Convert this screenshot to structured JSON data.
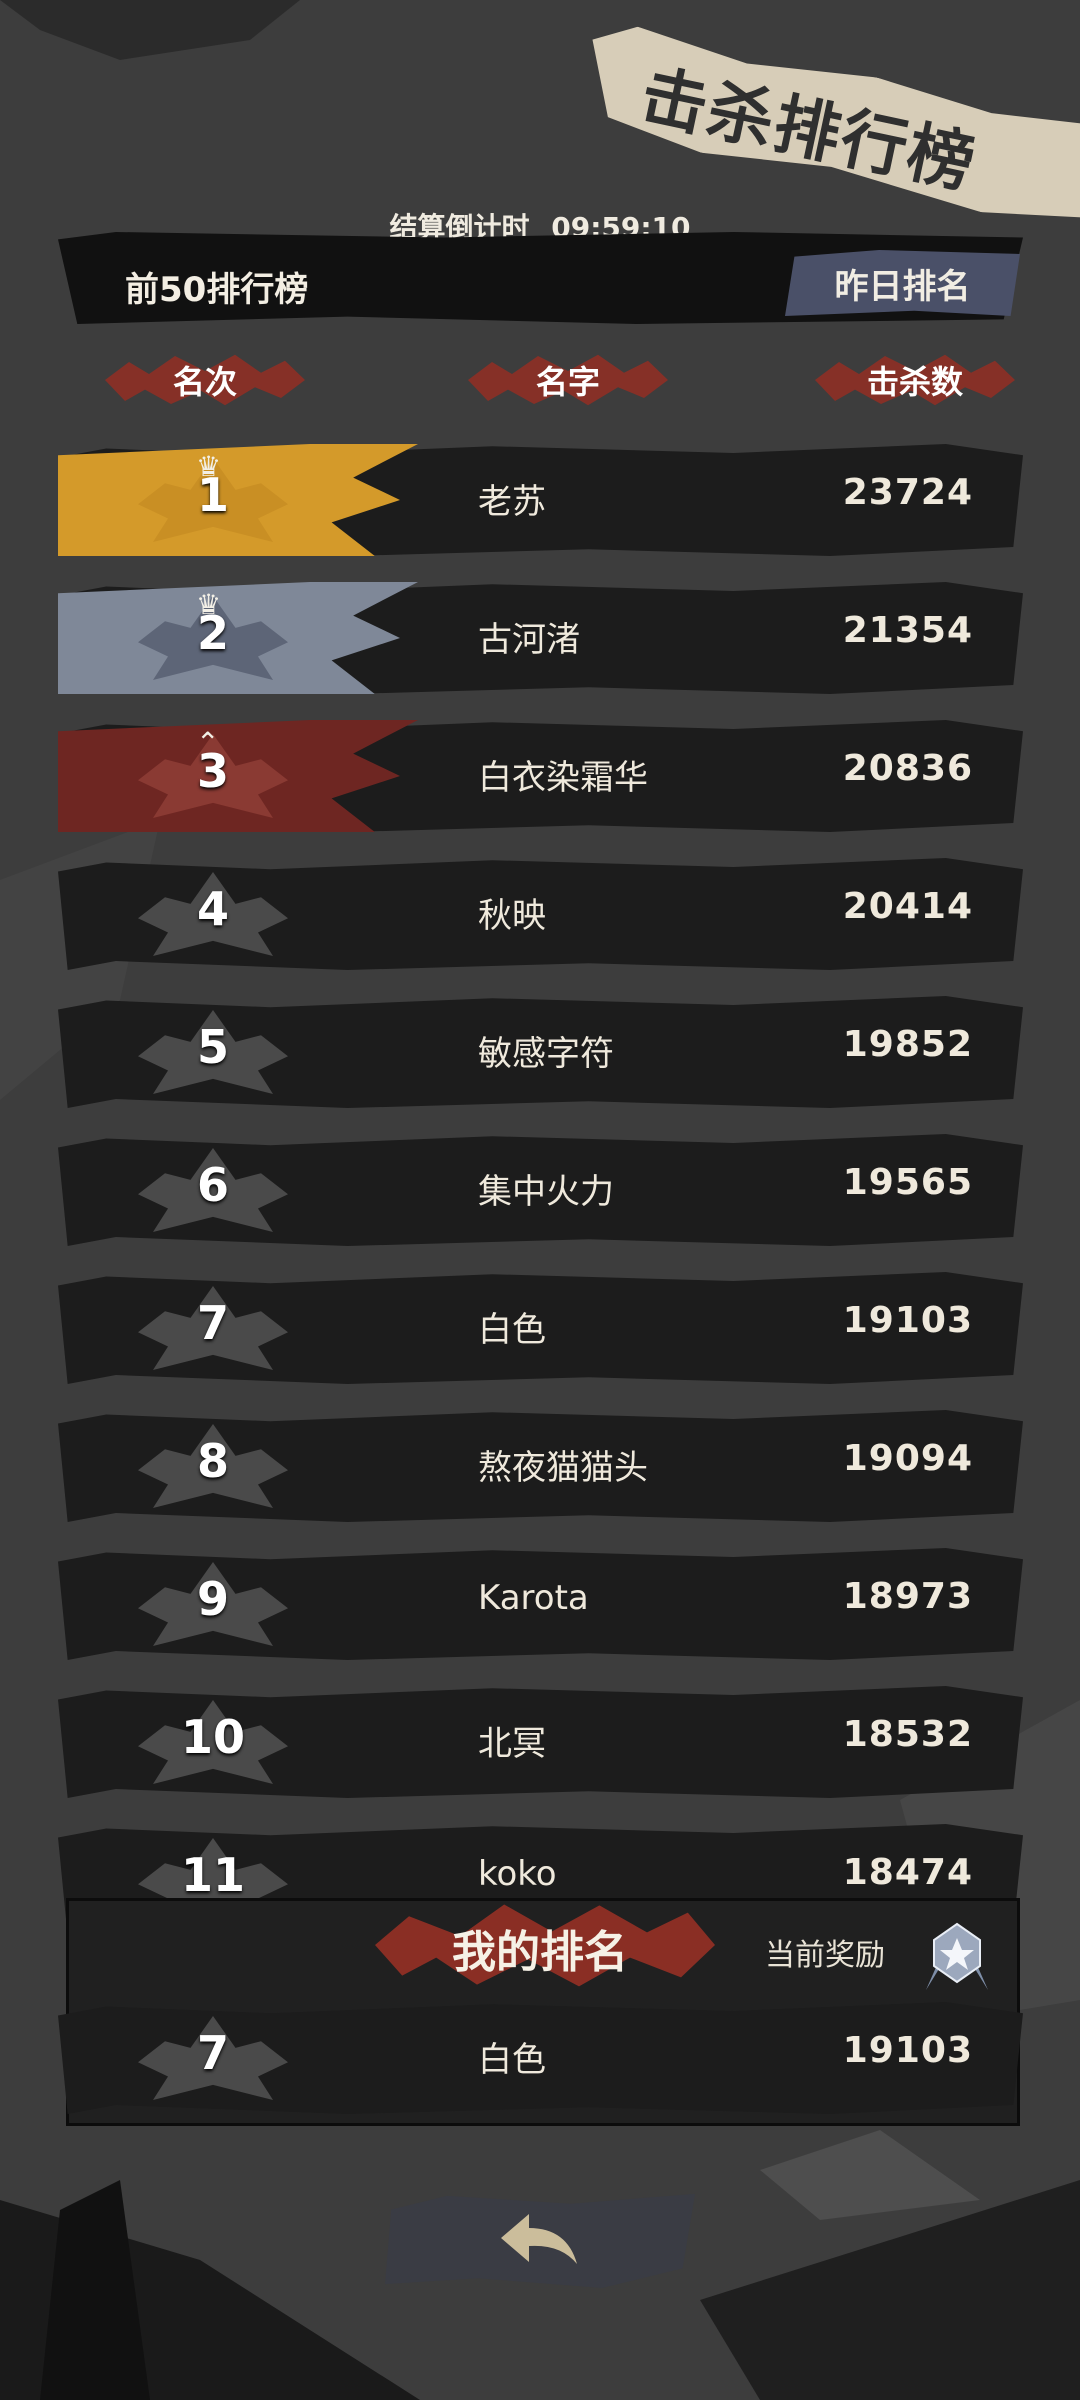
{
  "title": "击杀排行榜",
  "countdown": {
    "label": "结算倒计时",
    "time": "09:59:10"
  },
  "board_label": "前50排行榜",
  "yesterday_button": "昨日排名",
  "columns": {
    "rank": "名次",
    "name": "名字",
    "kills": "击杀数"
  },
  "rows": [
    {
      "rank": "1",
      "name": "老苏",
      "kills": "23724"
    },
    {
      "rank": "2",
      "name": "古河渚",
      "kills": "21354"
    },
    {
      "rank": "3",
      "name": "白衣染霜华",
      "kills": "20836"
    },
    {
      "rank": "4",
      "name": "秋映",
      "kills": "20414"
    },
    {
      "rank": "5",
      "name": "敏感字符",
      "kills": "19852"
    },
    {
      "rank": "6",
      "name": "集中火力",
      "kills": "19565"
    },
    {
      "rank": "7",
      "name": "白色",
      "kills": "19103"
    },
    {
      "rank": "8",
      "name": "熬夜猫猫头",
      "kills": "19094"
    },
    {
      "rank": "9",
      "name": "Karota",
      "kills": "18973"
    },
    {
      "rank": "10",
      "name": "北冥",
      "kills": "18532"
    },
    {
      "rank": "11",
      "name": "koko",
      "kills": "18474"
    }
  ],
  "my_rank": {
    "title": "我的排名",
    "reward_label": "当前奖励",
    "rank": "7",
    "name": "白色",
    "kills": "19103"
  },
  "colors": {
    "gold": "#d49a2a",
    "silver": "#8f98a8",
    "bronze": "#7a2a24",
    "banner_red": "#8e2f25",
    "button_blue": "#4a5068"
  },
  "icons": {
    "reward": "silver-medal-icon",
    "back": "back-arrow-icon"
  }
}
